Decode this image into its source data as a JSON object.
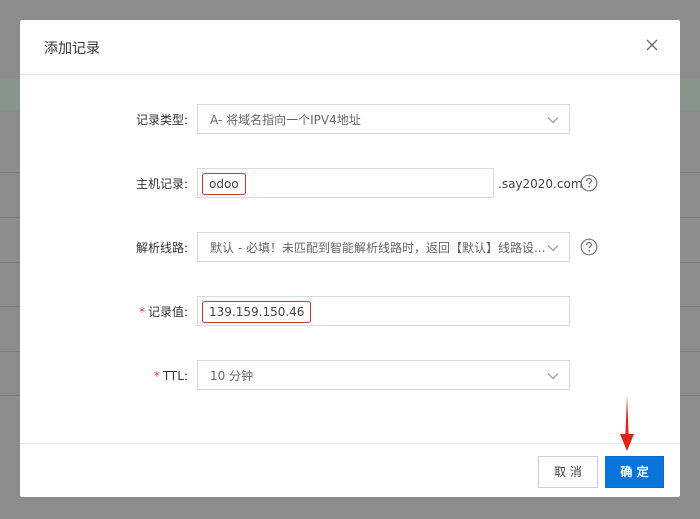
{
  "dialog": {
    "title": "添加记录"
  },
  "form": {
    "record_type": {
      "label": "记录类型:",
      "value": "A- 将域名指向一个IPV4地址"
    },
    "host": {
      "label": "主机记录:",
      "value": "odoo",
      "suffix": ".say2020.com"
    },
    "line": {
      "label": "解析线路:",
      "value": "默认 - 必填！未匹配到智能解析线路时，返回【默认】线路设..."
    },
    "record_value": {
      "required_mark": "*",
      "label": "记录值:",
      "value": "139.159.150.46"
    },
    "ttl": {
      "required_mark": "*",
      "label": "TTL:",
      "value": "10 分钟"
    }
  },
  "footer": {
    "cancel_label": "取 消",
    "ok_label": "确 定"
  },
  "icons": [
    "close-icon",
    "chevron-down-icon",
    "help-icon",
    "arrow-down-icon"
  ],
  "colors": {
    "primary": "#0a74da",
    "required": "#e8373d",
    "highlight_border": "#d43a2f",
    "annotation_arrow": "#e2231a"
  }
}
